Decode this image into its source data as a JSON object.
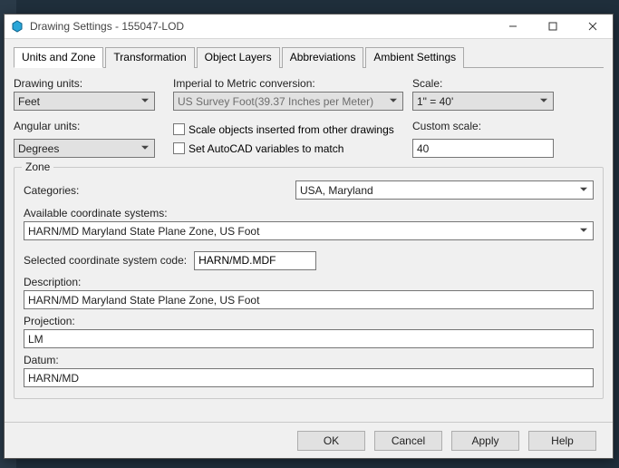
{
  "window": {
    "title": "Drawing Settings - 155047-LOD"
  },
  "tabs": {
    "t0": "Units and Zone",
    "t1": "Transformation",
    "t2": "Object Layers",
    "t3": "Abbreviations",
    "t4": "Ambient Settings"
  },
  "labels": {
    "drawing_units": "Drawing units:",
    "angular_units": "Angular units:",
    "imperial": "Imperial to Metric conversion:",
    "scale_objects": "Scale objects inserted from other drawings",
    "set_acad": "Set AutoCAD variables to match",
    "scale": "Scale:",
    "custom_scale": "Custom scale:",
    "zone": "Zone",
    "categories": "Categories:",
    "avail": "Available coordinate systems:",
    "sel_code": "Selected coordinate system code:",
    "description": "Description:",
    "projection": "Projection:",
    "datum": "Datum:"
  },
  "values": {
    "drawing_units": "Feet",
    "angular_units": "Degrees",
    "imperial": "US Survey Foot(39.37 Inches per Meter)",
    "scale": "1\" = 40'",
    "custom_scale": "40",
    "categories": "USA, Maryland",
    "avail": "HARN/MD Maryland State Plane Zone, US Foot",
    "code": "HARN/MD.MDF",
    "description": "HARN/MD Maryland State Plane Zone, US Foot",
    "projection": "LM",
    "datum": "HARN/MD"
  },
  "buttons": {
    "ok": "OK",
    "cancel": "Cancel",
    "apply": "Apply",
    "help": "Help"
  }
}
